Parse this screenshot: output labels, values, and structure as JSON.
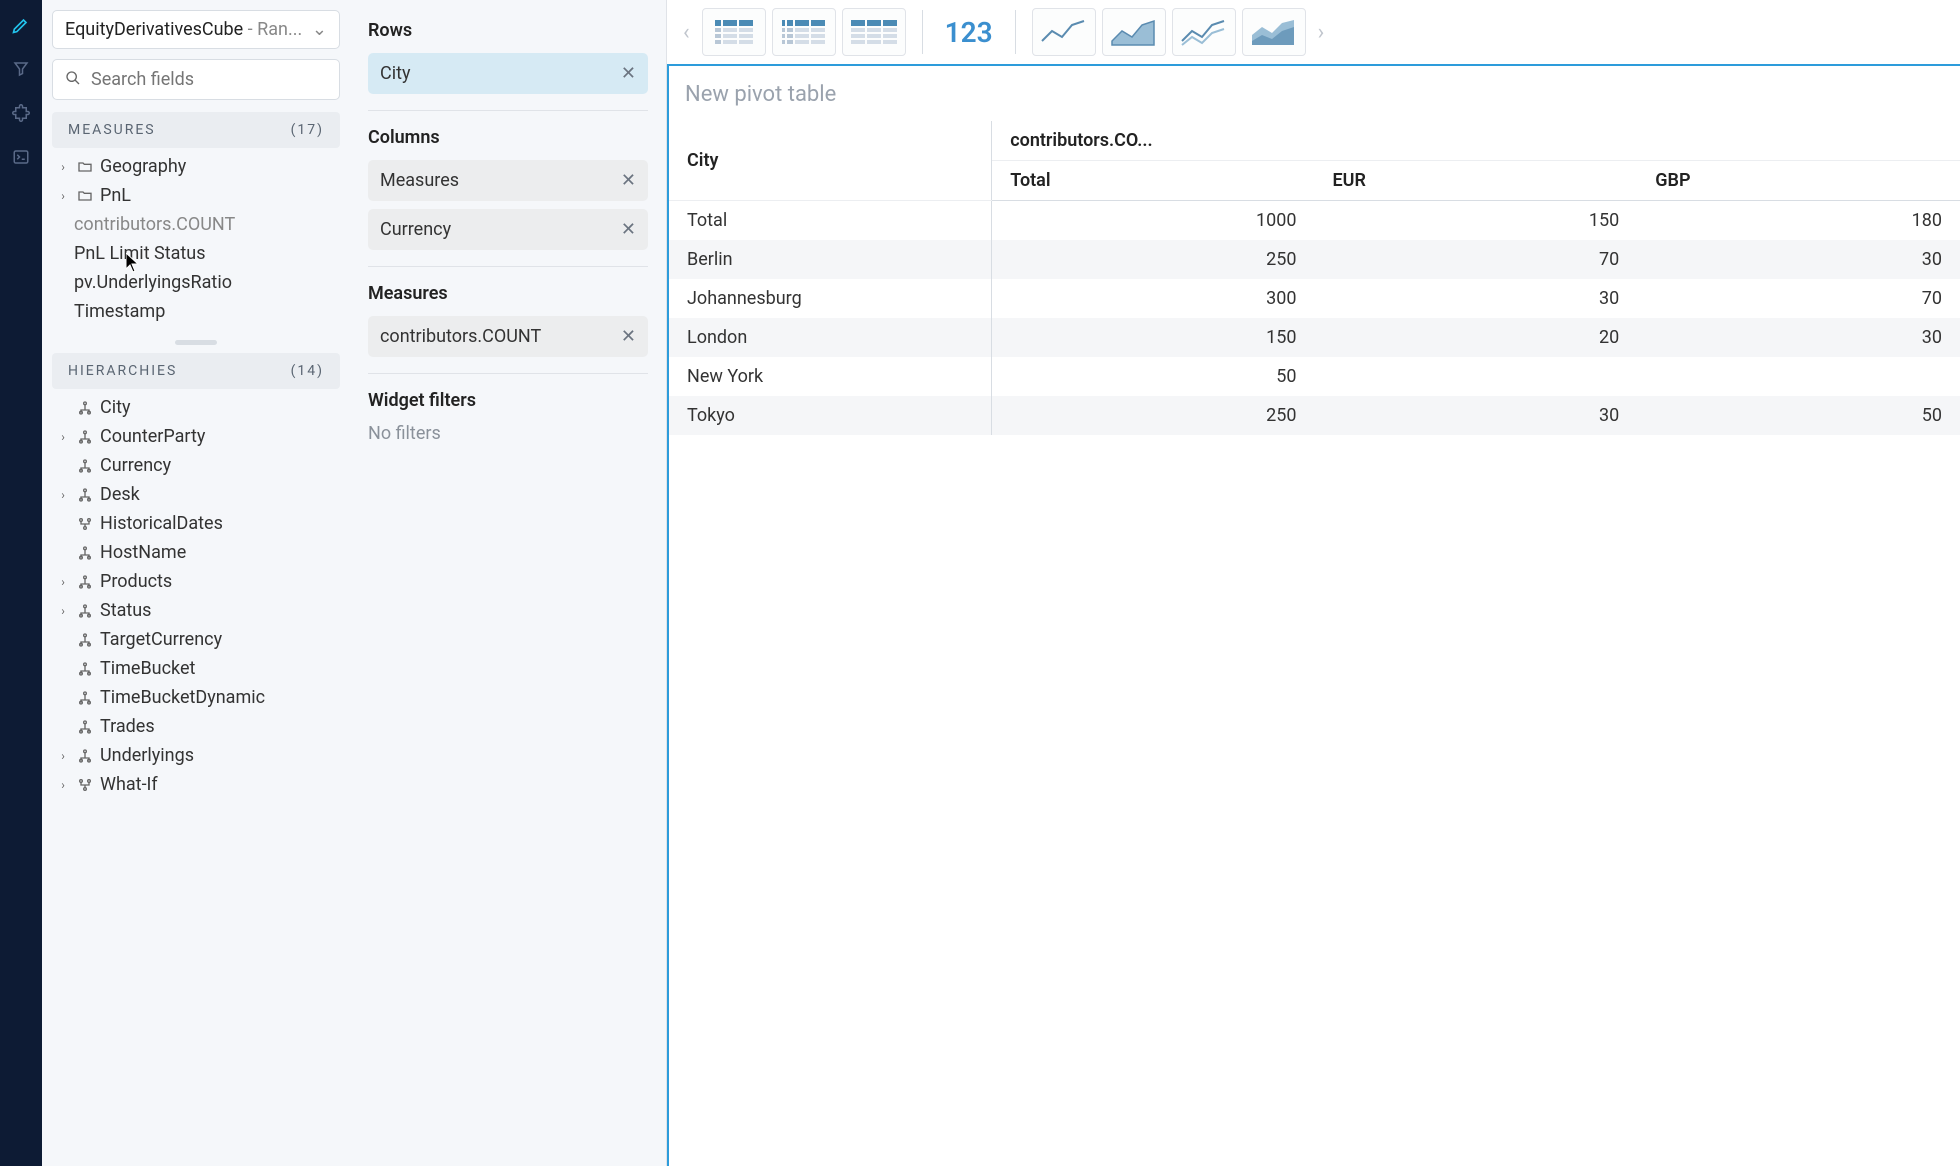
{
  "cube": {
    "name": "EquityDerivativesCube",
    "suffix": " - Ran..."
  },
  "search": {
    "placeholder": "Search fields"
  },
  "measures_section": {
    "title": "MEASURES",
    "count": "(17)"
  },
  "measures": {
    "geography": "Geography",
    "pnl": "PnL",
    "contributors": "contributors.COUNT",
    "pnlLimit": "PnL Limit Status",
    "underlyings": "pv.UnderlyingsRatio",
    "timestamp": "Timestamp"
  },
  "hierarchies_section": {
    "title": "HIERARCHIES",
    "count": "(14)"
  },
  "hierarchies": {
    "city": "City",
    "counterparty": "CounterParty",
    "currency": "Currency",
    "desk": "Desk",
    "historical": "HistoricalDates",
    "hostname": "HostName",
    "products": "Products",
    "status": "Status",
    "targetcurrency": "TargetCurrency",
    "timebucket": "TimeBucket",
    "timebucketdyn": "TimeBucketDynamic",
    "trades": "Trades",
    "underlyings": "Underlyings",
    "whatif": "What-If"
  },
  "config": {
    "rows_title": "Rows",
    "columns_title": "Columns",
    "measures_title": "Measures",
    "filters_title": "Widget filters",
    "no_filters": "No filters",
    "rows": {
      "city": "City"
    },
    "columns": {
      "measures": "Measures",
      "currency": "Currency"
    },
    "measures": {
      "contributors": "contributors.COUNT"
    }
  },
  "toolbar": {
    "kpi": "123"
  },
  "pivot": {
    "title": "New pivot table",
    "row_header": "City",
    "col_header": "contributors.CO...",
    "subcols": {
      "total": "Total",
      "eur": "EUR",
      "gbp": "GBP"
    },
    "rows": [
      {
        "label": "Total",
        "total": "1000",
        "eur": "150",
        "gbp": "180"
      },
      {
        "label": "Berlin",
        "total": "250",
        "eur": "70",
        "gbp": "30"
      },
      {
        "label": "Johannesburg",
        "total": "300",
        "eur": "30",
        "gbp": "70"
      },
      {
        "label": "London",
        "total": "150",
        "eur": "20",
        "gbp": "30"
      },
      {
        "label": "New York",
        "total": "50",
        "eur": "",
        "gbp": ""
      },
      {
        "label": "Tokyo",
        "total": "250",
        "eur": "30",
        "gbp": "50"
      }
    ]
  }
}
